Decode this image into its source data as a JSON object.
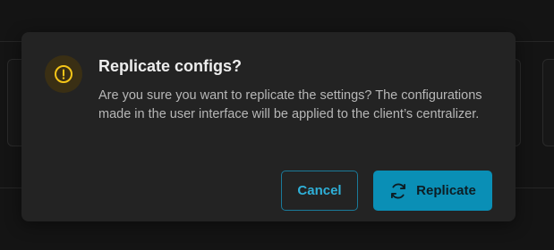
{
  "dialog": {
    "title": "Replicate configs?",
    "message": "Are you sure you want to replicate the settings? The configurations made in the user interface will be applied to the client’s centralizer.",
    "icon": "warning-circle-icon",
    "cancel_label": "Cancel",
    "confirm_label": "Replicate",
    "confirm_icon": "refresh-icon"
  },
  "colors": {
    "accent": "#0a8fb6",
    "warning": "#f5c518",
    "dialog_bg": "#232323"
  }
}
